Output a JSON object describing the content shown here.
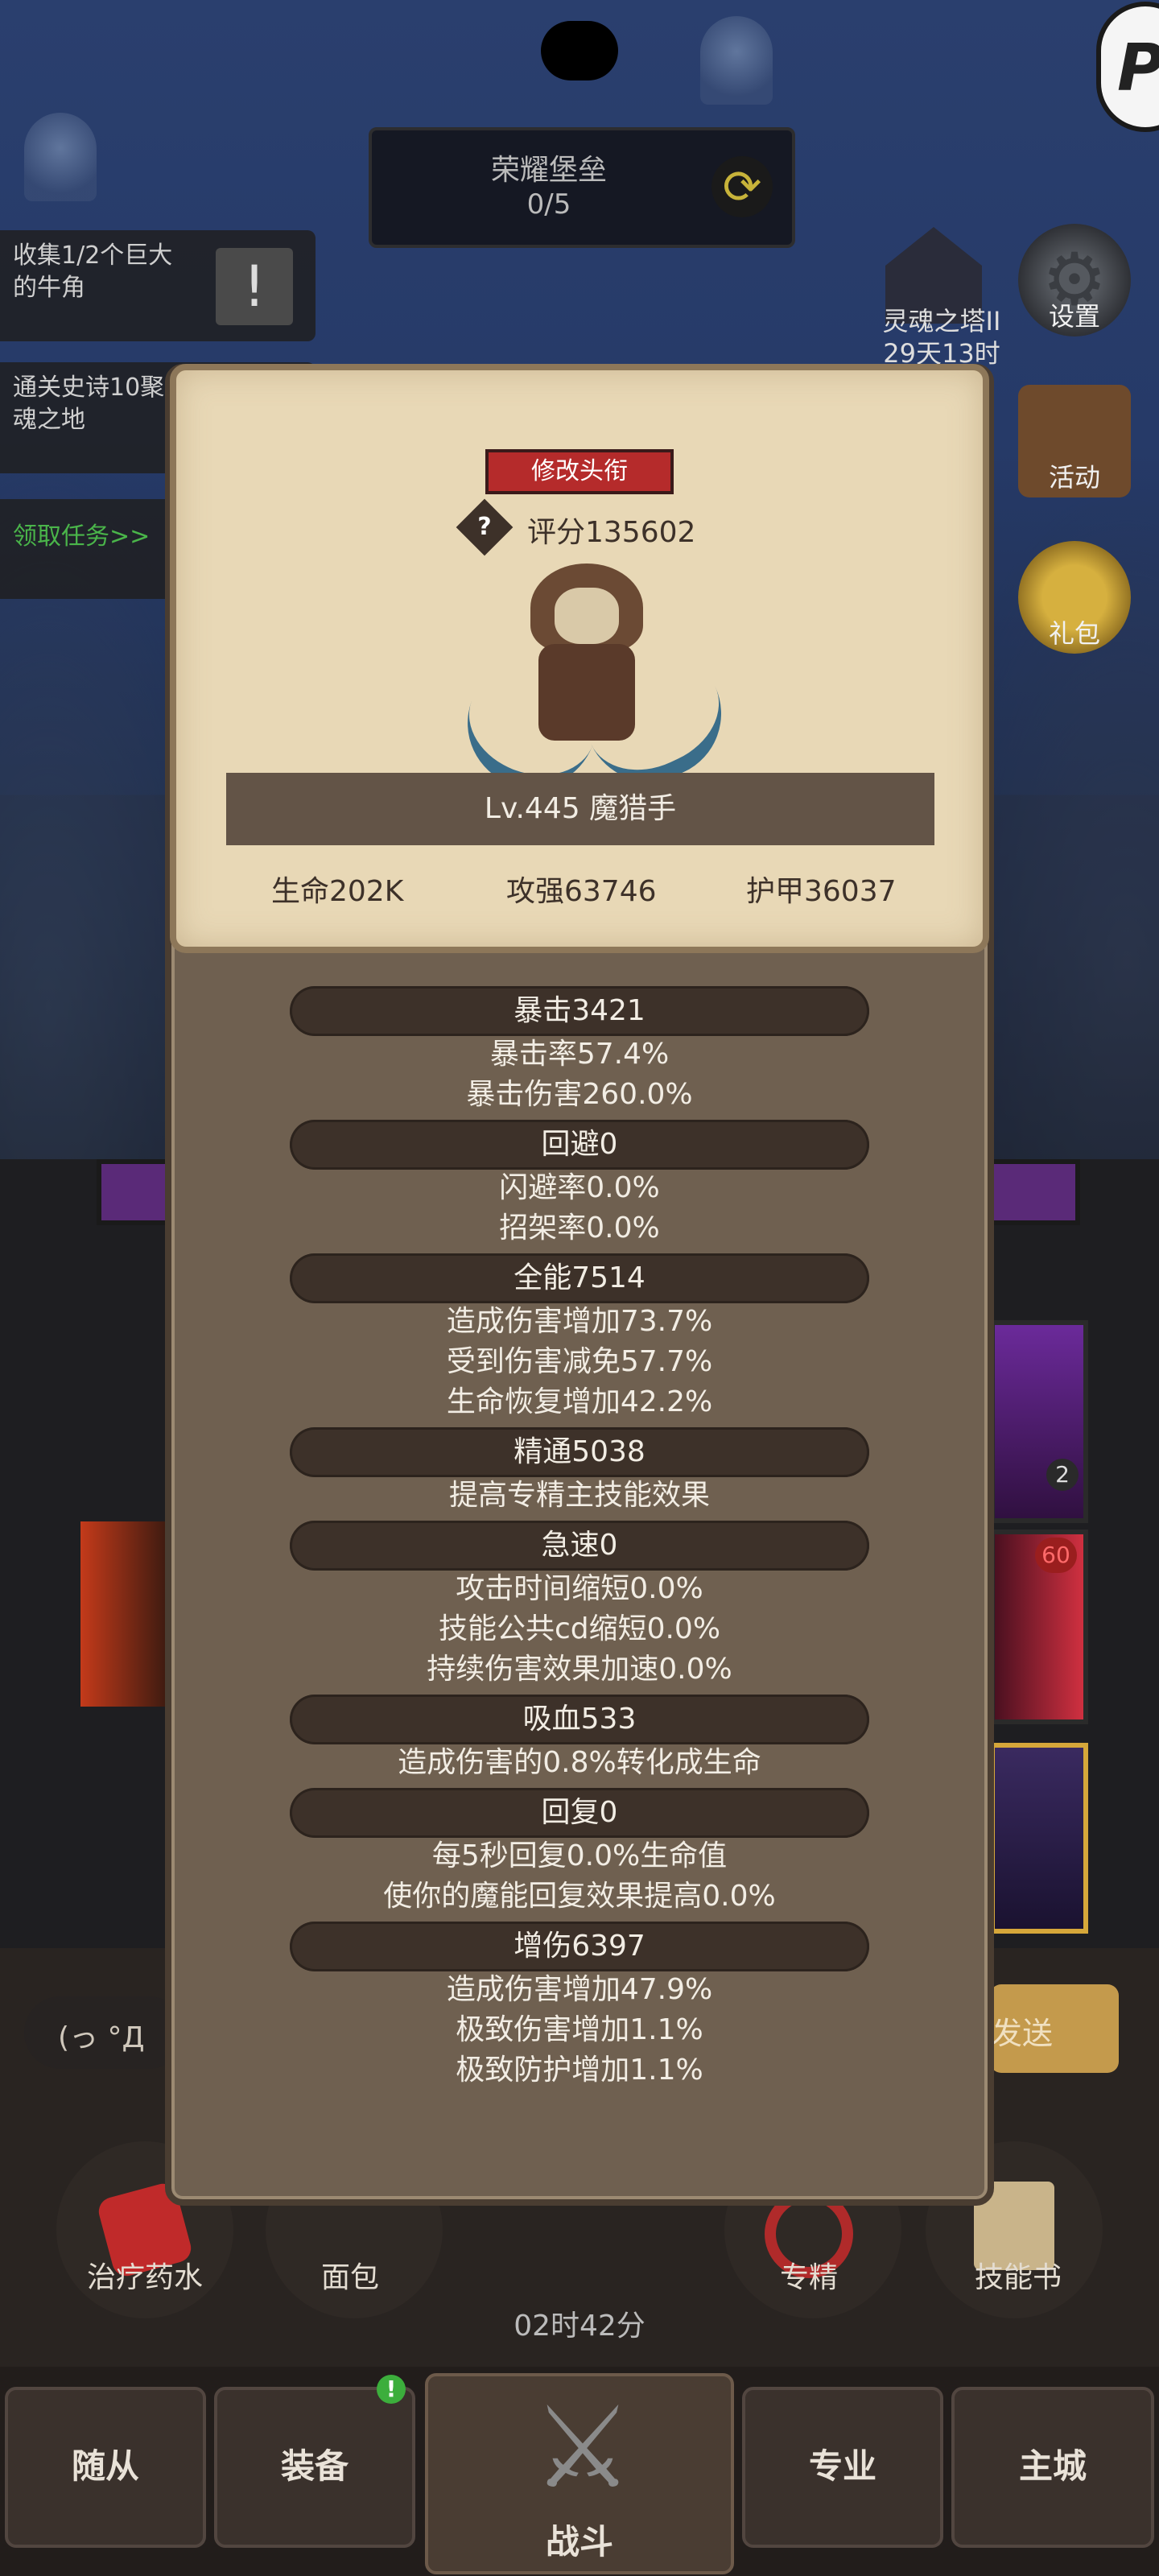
{
  "top_banner": {
    "title": "荣耀堡垒",
    "progress": "0/5"
  },
  "quests": [
    {
      "text": "收集1/2个巨大的牛角"
    },
    {
      "text": "通关史诗10聚魂之地"
    },
    {
      "text": "领取任务>>"
    }
  ],
  "soul_tower": {
    "label": "灵魂之塔II",
    "timer": "29天13时"
  },
  "side_menu": {
    "settings": "设置",
    "activity": "活动",
    "gift": "礼包"
  },
  "hero": {
    "change_title_button": "修改头衔",
    "score": "评分135602",
    "level_name": "Lv.445 魔猎手",
    "hp": "生命202K",
    "attack": "攻强63746",
    "armor": "护甲36037"
  },
  "stats": [
    {
      "header": "暴击3421",
      "lines": [
        "暴击率57.4%",
        "暴击伤害260.0%"
      ]
    },
    {
      "header": "回避0",
      "lines": [
        "闪避率0.0%",
        "招架率0.0%"
      ]
    },
    {
      "header": "全能7514",
      "lines": [
        "造成伤害增加73.7%",
        "受到伤害减免57.7%",
        "生命恢复增加42.2%"
      ]
    },
    {
      "header": "精通5038",
      "lines": [
        "提高专精主技能效果"
      ]
    },
    {
      "header": "急速0",
      "lines": [
        "攻击时间缩短0.0%",
        "技能公共cd缩短0.0%",
        "持续伤害效果加速0.0%"
      ]
    },
    {
      "header": "吸血533",
      "lines": [
        "造成伤害的0.8%转化成生命"
      ]
    },
    {
      "header": "回复0",
      "lines": [
        "每5秒回复0.0%生命值",
        "使你的魔能回复效果提高0.0%"
      ]
    },
    {
      "header": "增伤6397",
      "lines": [
        "造成伤害增加47.9%",
        "极致伤害增加1.1%",
        "极致防护增加1.1%"
      ]
    }
  ],
  "chat": {
    "placeholder": "(っ °Д",
    "send": "发送"
  },
  "skill_badges": {
    "count": "2",
    "cooldown": "60"
  },
  "tools": [
    {
      "label": "治疗药水"
    },
    {
      "label": "面包"
    },
    {
      "label": "专精"
    },
    {
      "label": "技能书"
    }
  ],
  "timer": "02时42分",
  "bottom_nav": {
    "followers": "随从",
    "equipment": "装备",
    "battle": "战斗",
    "profession": "专业",
    "main_city": "主城"
  },
  "colors": {
    "red_button": "#b52b2b",
    "dialog_bg": "#6f6050",
    "card_bg": "#e8d8b6",
    "stat_bar": "#3d3129"
  }
}
